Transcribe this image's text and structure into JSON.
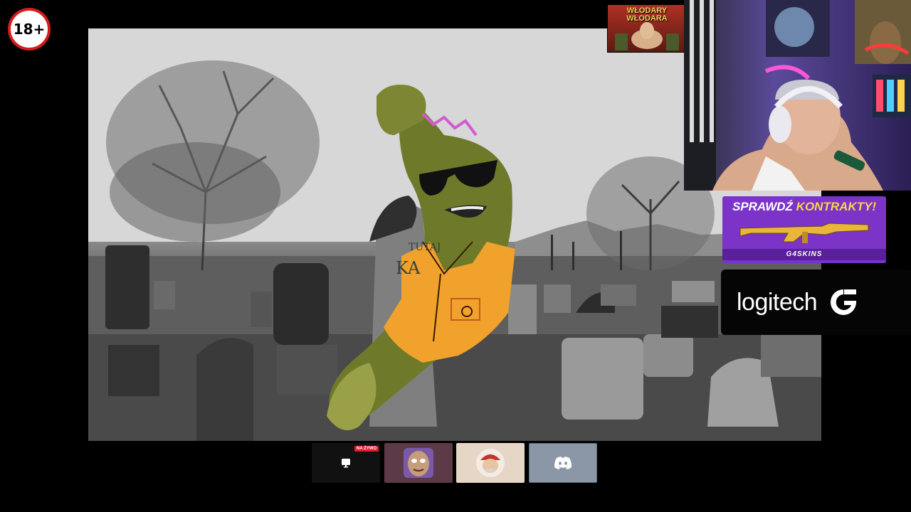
{
  "age_rating": "18+",
  "sticker": {
    "title_line1": "WŁODARY",
    "title_line2": "WŁODARA"
  },
  "promo": {
    "title_part1": "SPRAWDŹ ",
    "title_part2": "KONTRAKTY!",
    "brand": "G4SKINS"
  },
  "sponsor": {
    "name": "logitech"
  },
  "live_tile": {
    "badge": "NA ŻYWO"
  },
  "tiles": [
    "live-screen",
    "participant-1",
    "participant-2",
    "discord"
  ],
  "icons": [
    "monitor-icon",
    "discord-icon",
    "g-logo-icon"
  ],
  "colors": {
    "badge_ring": "#d41c1c",
    "promo_bg": "#7b33c8",
    "promo_highlight": "#f7d64a",
    "live_red": "#e01d2b",
    "discord_tile": "#8b97a7"
  }
}
